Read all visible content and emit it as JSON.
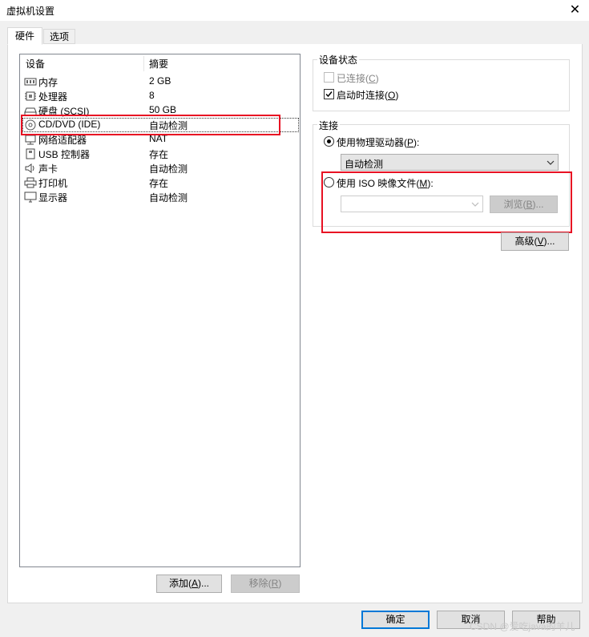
{
  "window": {
    "title": "虚拟机设置",
    "close_glyph": "✕"
  },
  "tabs": [
    {
      "label": "硬件"
    },
    {
      "label": "选项"
    }
  ],
  "device_list": {
    "headers": {
      "device": "设备",
      "summary": "摘要"
    },
    "rows": [
      {
        "name": "内存",
        "summary": "2 GB",
        "icon": "memory-icon"
      },
      {
        "name": "处理器",
        "summary": "8",
        "icon": "cpu-icon"
      },
      {
        "name": "硬盘 (SCSI)",
        "summary": "50 GB",
        "icon": "hard-disk-icon"
      },
      {
        "name": "CD/DVD (IDE)",
        "summary": "自动检测",
        "icon": "cd-dvd-icon"
      },
      {
        "name": "网络适配器",
        "summary": "NAT",
        "icon": "network-adapter-icon"
      },
      {
        "name": "USB 控制器",
        "summary": "存在",
        "icon": "usb-icon"
      },
      {
        "name": "声卡",
        "summary": "自动检测",
        "icon": "speaker-icon"
      },
      {
        "name": "打印机",
        "summary": "存在",
        "icon": "printer-icon"
      },
      {
        "name": "显示器",
        "summary": "自动检测",
        "icon": "monitor-icon"
      }
    ],
    "selected": "CD/DVD (IDE)"
  },
  "list_buttons": {
    "add": {
      "text": "添加(",
      "key": "A",
      "suffix": ")..."
    },
    "remove": {
      "text": "移除(",
      "key": "R",
      "suffix": ")"
    }
  },
  "device_status": {
    "title": "设备状态",
    "connected": {
      "text": "已连接(",
      "key": "C",
      "suffix": ")",
      "checked": false,
      "enabled": false
    },
    "connect_at_power_on": {
      "text": "启动时连接(",
      "key": "O",
      "suffix": ")",
      "checked": true
    }
  },
  "connection": {
    "title": "连接",
    "physical_drive": {
      "text": "使用物理驱动器(",
      "key": "P",
      "suffix": "):",
      "selected": true
    },
    "physical_drive_value": "自动检测",
    "iso_image": {
      "text": "使用 ISO 映像文件(",
      "key": "M",
      "suffix": "):",
      "selected": false
    },
    "iso_value": "",
    "browse": {
      "text": "浏览(",
      "key": "B",
      "suffix": ")..."
    }
  },
  "advanced_button": {
    "text": "高级(",
    "key": "V",
    "suffix": ")..."
  },
  "footer": {
    "ok": "确定",
    "cancel": "取消",
    "help": "帮助",
    "watermark": "CSDN @爱吃java的羊儿"
  },
  "colors": {
    "highlight_box": "#e81123",
    "default_button_border": "#0078d7"
  }
}
